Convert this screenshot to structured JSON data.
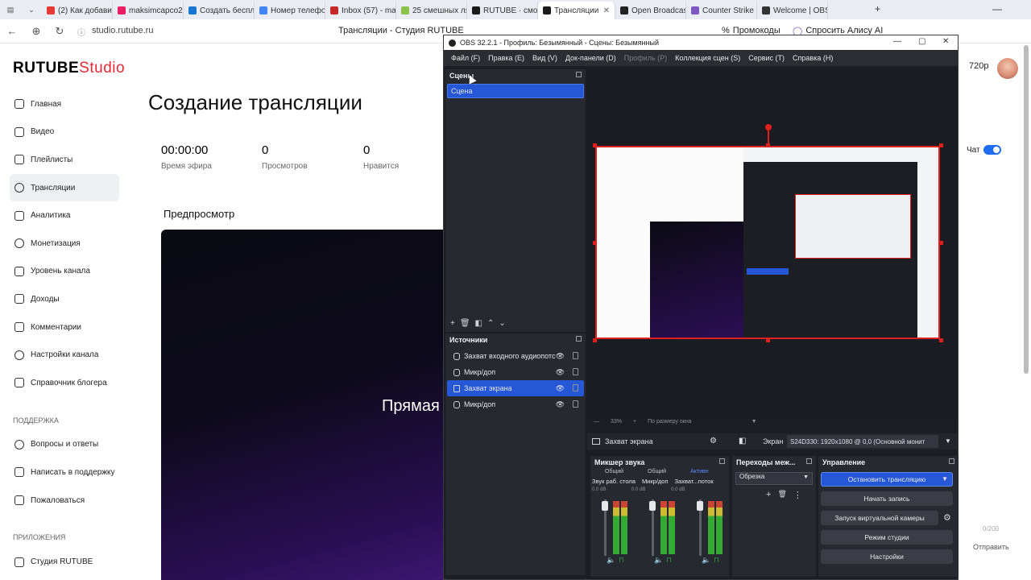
{
  "browser": {
    "tabs": [
      {
        "label": "(2) Как добави",
        "color": "#e53935"
      },
      {
        "label": "maksimcapco25",
        "color": "#e91e63"
      },
      {
        "label": "Создать беспл",
        "color": "#1976d2"
      },
      {
        "label": "Номер телефо",
        "color": "#4285f4"
      },
      {
        "label": "Inbox (57) - ma",
        "color": "#c62828"
      },
      {
        "label": "25 смешных ля",
        "color": "#8bc34a"
      },
      {
        "label": "RUTUBE · смот",
        "color": "#1a1a1a"
      },
      {
        "label": "Трансляции",
        "color": "#1a1a1a"
      },
      {
        "label": "Open Broadcas",
        "color": "#222"
      },
      {
        "label": "Counter Strike",
        "color": "#7e57c2"
      },
      {
        "label": "Welcome | OBS",
        "color": "#333"
      }
    ],
    "url": "studio.rutube.ru",
    "page_title": "Трансляции - Студия RUTUBE",
    "promo_label": "Промокоды",
    "alice_label": "Спросить Алису AI"
  },
  "studio": {
    "logo_main": "RUTUBE",
    "logo_sub": "Studio",
    "nav": [
      "Главная",
      "Видео",
      "Плейлисты",
      "Трансляции",
      "Аналитика",
      "Монетизация",
      "Уровень канала",
      "Доходы",
      "Комментарии",
      "Настройки канала",
      "Справочник блогера"
    ],
    "support_header": "ПОДДЕРЖКА",
    "support": [
      "Вопросы и ответы",
      "Написать в поддержку",
      "Пожаловаться"
    ],
    "apps_header": "ПРИЛОЖЕНИЯ",
    "apps": [
      "Студия RUTUBE"
    ],
    "title": "Создание трансляции",
    "stats": [
      {
        "value": "00:00:00",
        "label": "Время эфира"
      },
      {
        "value": "0",
        "label": "Просмотров"
      },
      {
        "value": "0",
        "label": "Нравится"
      }
    ],
    "preview_label": "Предпросмотр",
    "preview_text": "Прямая",
    "quality": "720p",
    "chat_label": "Чат",
    "counter": "0/200",
    "send_label": "Отправить"
  },
  "obs": {
    "title": "OBS 32.2.1 - Профиль: Безымянный - Сцены: Безымянный",
    "menu": [
      "Файл (F)",
      "Правка (E)",
      "Вид (V)",
      "Док-панели (D)",
      "Профиль (P)",
      "Коллекция сцен (S)",
      "Сервис (T)",
      "Справка (H)"
    ],
    "scenes_title": "Сцены",
    "scenes": [
      "Сцена"
    ],
    "sources_title": "Источники",
    "sources": [
      "Захват входного аудиопотс",
      "Микр/доп",
      "Захват экрана",
      "Микр/доп"
    ],
    "selected_source_index": 2,
    "zoom": "33%",
    "fit_label": "По размеру окна",
    "props_source": "Захват экрана",
    "display_label": "Экран",
    "display_value": "S24D330: 1920x1080 @ 0,0 (Основной монит",
    "mixer_title": "Микшер звука",
    "mixer_tabs": [
      "Общий",
      "Общий",
      "Активн"
    ],
    "mixer_channels": [
      "Звук раб. стола",
      "Микр/доп",
      "Захват...поток"
    ],
    "mixer_db": [
      "0.0 dB",
      "0.0 dB",
      "0.0 dB"
    ],
    "transitions_title": "Переходы меж...",
    "transition_value": "Обрезка",
    "control_title": "Управление",
    "controls": [
      "Остановить трансляцию",
      "Начать запись",
      "Запуск виртуальной камеры",
      "Режим студии",
      "Настройки"
    ],
    "accent": "#2557d6",
    "selection_color": "#e02020"
  }
}
